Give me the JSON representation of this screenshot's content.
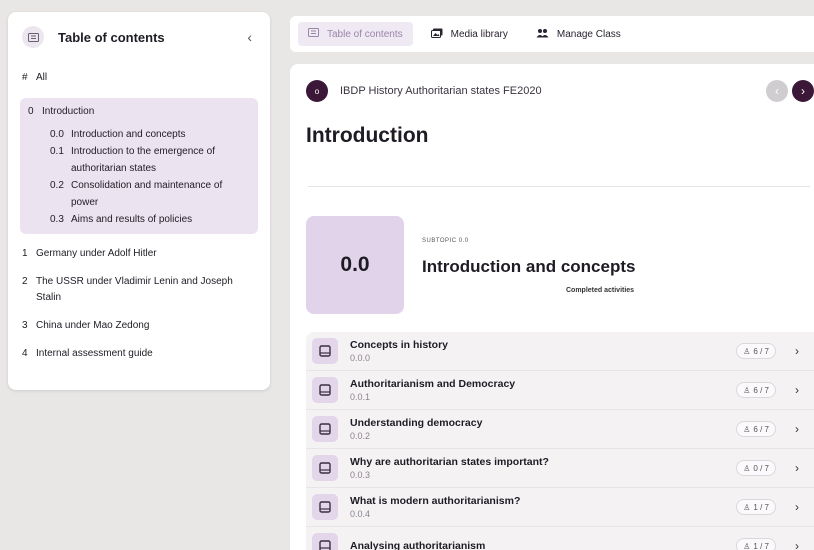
{
  "sidebar": {
    "title": "Table of contents",
    "collapse_icon": "chevron-left",
    "all": {
      "num": "#",
      "label": "All"
    },
    "intro": {
      "num": "0",
      "label": "Introduction",
      "subs": [
        {
          "num": "0.0",
          "label": "Introduction and concepts"
        },
        {
          "num": "0.1",
          "label": "Introduction to the emergence of authoritarian states"
        },
        {
          "num": "0.2",
          "label": "Consolidation and maintenance of power"
        },
        {
          "num": "0.3",
          "label": "Aims and results of policies"
        }
      ]
    },
    "chapters": [
      {
        "num": "1",
        "label": "Germany under Adolf Hitler"
      },
      {
        "num": "2",
        "label": "The USSR under Vladimir Lenin and Joseph Stalin"
      },
      {
        "num": "3",
        "label": "China under Mao Zedong"
      },
      {
        "num": "4",
        "label": "Internal assessment guide"
      }
    ]
  },
  "tabs": [
    {
      "label": "Table of contents",
      "icon": "list-icon",
      "active": true
    },
    {
      "label": "Media library",
      "icon": "media-icon",
      "active": false
    },
    {
      "label": "Manage Class",
      "icon": "users-icon",
      "active": false
    }
  ],
  "course": {
    "badge": "o",
    "name": "IBDP History Authoritarian states FE2020"
  },
  "page_title": "Introduction",
  "subtopic": {
    "number": "0.0",
    "label": "SUBTOPIC 0.0",
    "title": "Introduction and concepts",
    "completed_label": "Completed activities"
  },
  "activities": [
    {
      "name": "Concepts in history",
      "num": "0.0.0",
      "progress": "6 / 7"
    },
    {
      "name": "Authoritarianism and Democracy",
      "num": "0.0.1",
      "progress": "6 / 7"
    },
    {
      "name": "Understanding democracy",
      "num": "0.0.2",
      "progress": "6 / 7"
    },
    {
      "name": "Why are authoritarian states important?",
      "num": "0.0.3",
      "progress": "0 / 7"
    },
    {
      "name": "What is modern authoritarianism?",
      "num": "0.0.4",
      "progress": "1 / 7"
    },
    {
      "name": "Analysing authoritarianism",
      "num": "",
      "progress": "1 / 7"
    }
  ],
  "colors": {
    "accent_dark": "#3b1838",
    "accent_light": "#e1d3ea",
    "active_bg": "#ece3f1"
  }
}
